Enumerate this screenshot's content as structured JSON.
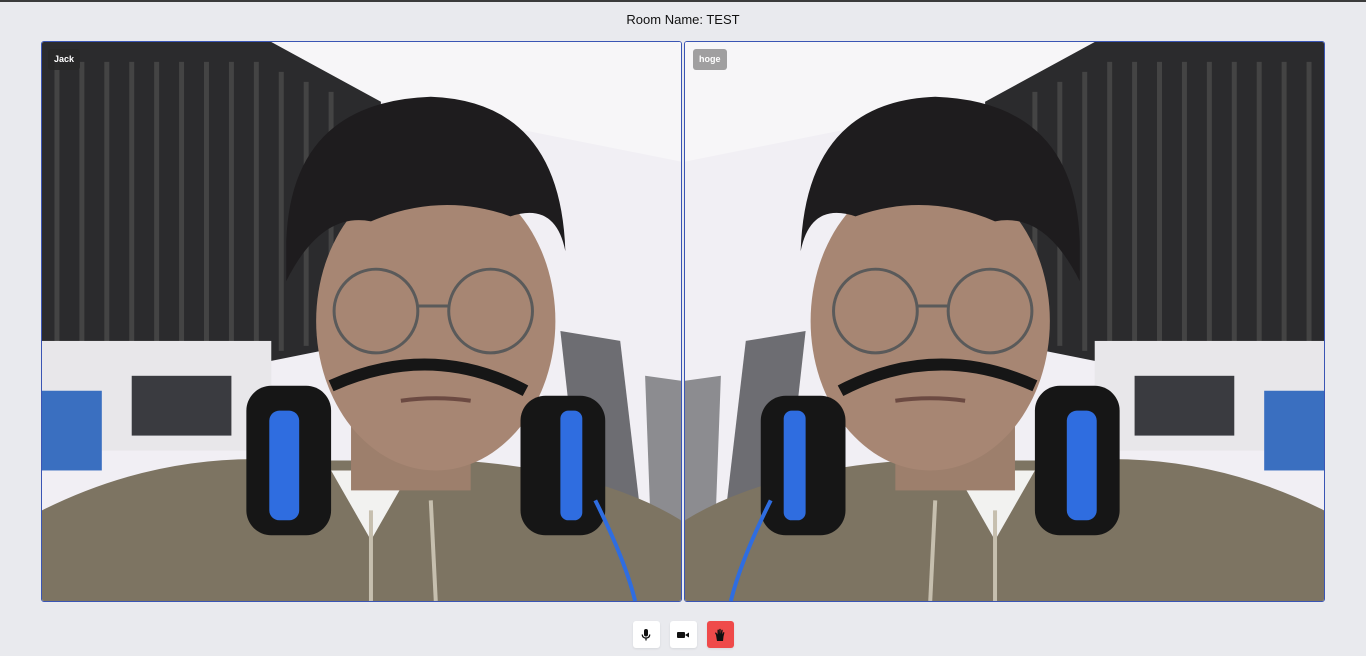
{
  "room": {
    "label": "Room Name: TEST"
  },
  "participants": [
    {
      "name": "Jack"
    },
    {
      "name": "hoge"
    }
  ],
  "controls": {
    "mic_icon": "microphone-icon",
    "camera_icon": "video-camera-icon",
    "hand_icon": "raise-hand-icon"
  },
  "colors": {
    "background": "#e9eaee",
    "tile_border": "#3a55b4",
    "hand_button": "#ef4a4a"
  }
}
